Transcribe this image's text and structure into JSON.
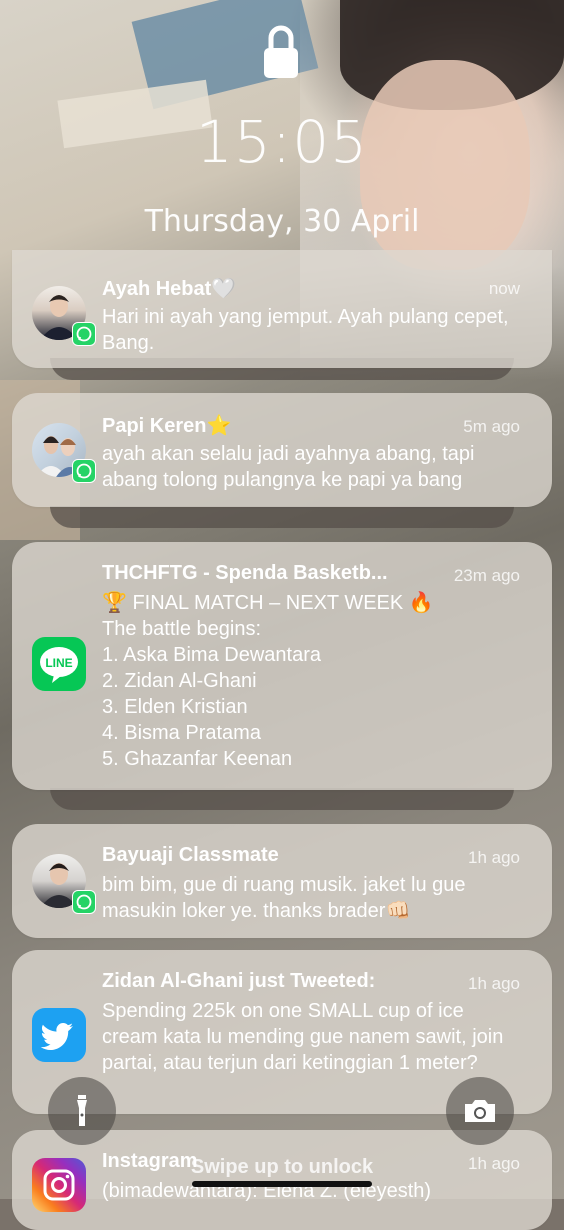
{
  "lockscreen": {
    "time": "15:05",
    "date": "Thursday, 30 April",
    "unlock_hint": "Swipe up to unlock"
  },
  "notifications": [
    {
      "app": "WhatsApp",
      "title": "Ayah Hebat🤍",
      "time": "now",
      "body": "Hari ini ayah yang jemput. Ayah pulang cepet, Bang."
    },
    {
      "app": "WhatsApp",
      "title": "Papi Keren⭐",
      "time": "5m ago",
      "body": "ayah akan selalu jadi ayahnya abang, tapi abang tolong pulangnya ke papi ya bang"
    },
    {
      "app": "LINE",
      "title": "THCHFTG - Spenda Basketb...",
      "time": "23m ago",
      "lines": [
        "🏆 FINAL MATCH – NEXT WEEK 🔥",
        "The battle begins:",
        "1. Aska Bima Dewantara",
        "2. Zidan Al-Ghani",
        "3. Elden Kristian",
        "4. Bisma Pratama",
        "5. Ghazanfar Keenan"
      ]
    },
    {
      "app": "WhatsApp",
      "title": "Bayuaji Classmate",
      "time": "1h ago",
      "body": "bim bim, gue di ruang musik. jaket lu gue masukin loker ye. thanks brader👊🏻"
    },
    {
      "app": "Twitter",
      "title": "Zidan Al-Ghani just Tweeted:",
      "time": "1h ago",
      "body": "Spending 225k on one SMALL cup of ice cream kata lu mending gue nanem sawit, join partai, atau terjun dari ketinggian 1 meter?"
    },
    {
      "app": "Instagram",
      "title": "Instagram",
      "time": "1h ago",
      "body": "(bimadewantara): Elena Z. (eleyesth)"
    }
  ],
  "icons": {
    "lock": "padlock",
    "flashlight": "flashlight",
    "camera": "camera",
    "line_logo_text": "LINE"
  },
  "colors": {
    "whatsapp": "#25d366",
    "line": "#06c755",
    "twitter": "#1da1f2"
  }
}
